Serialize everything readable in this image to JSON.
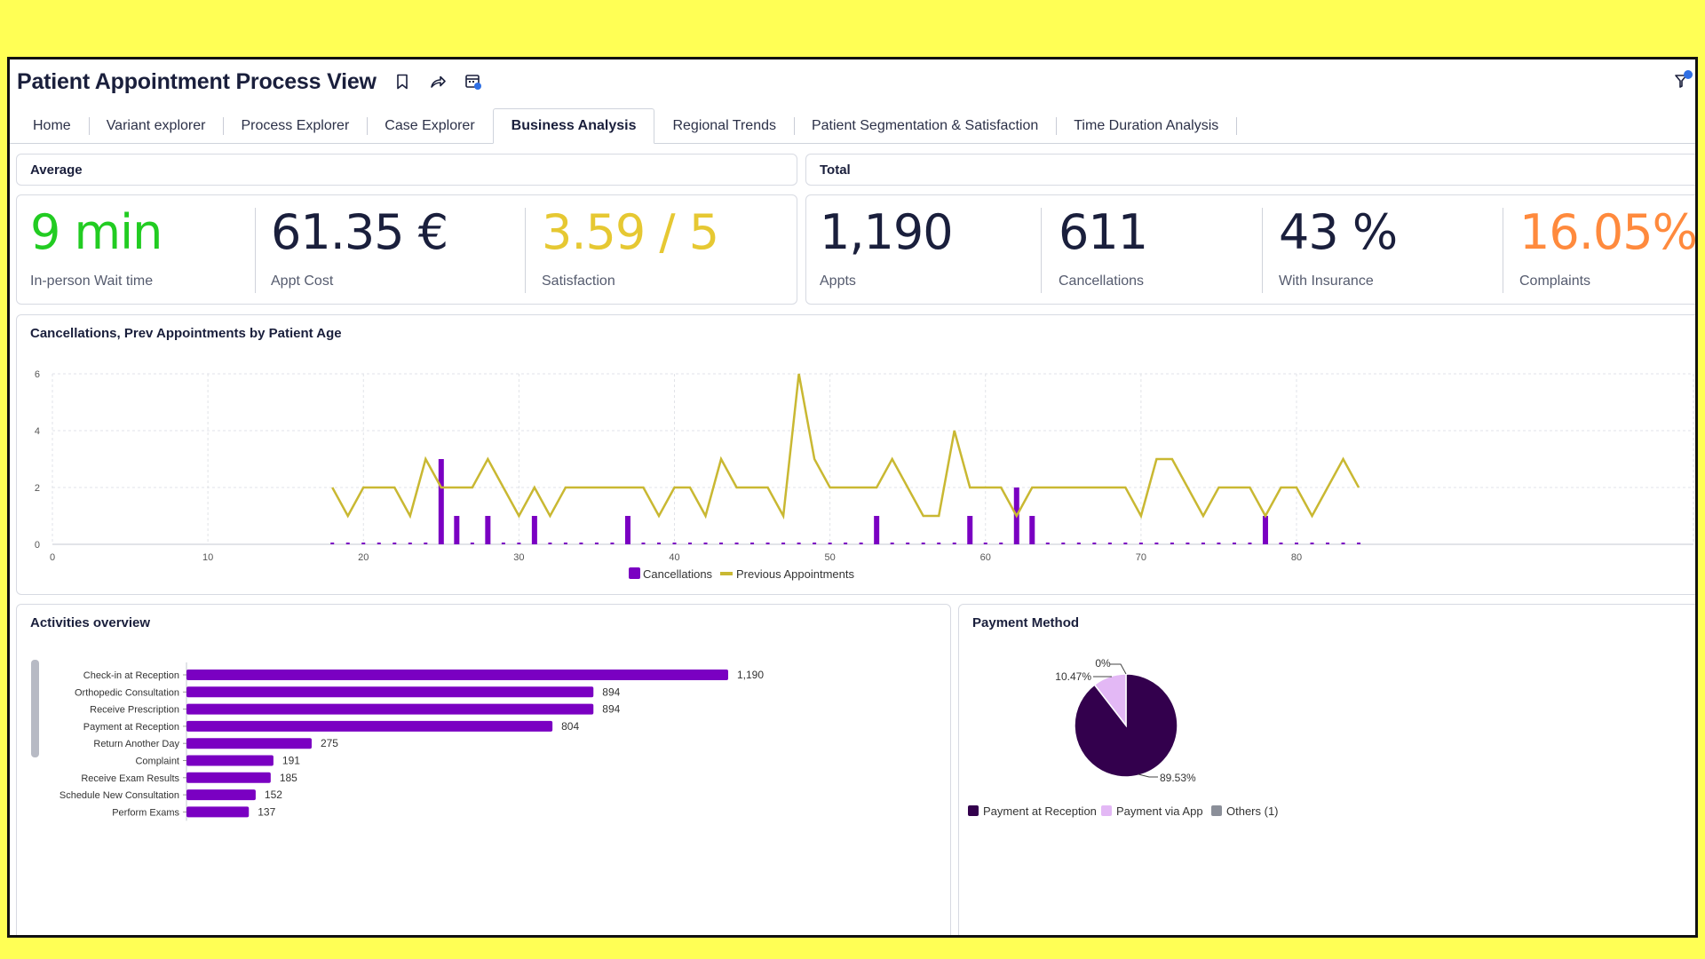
{
  "header": {
    "title": "Patient Appointment Process View"
  },
  "icons": {
    "bookmark": "bookmark-icon",
    "share": "share-icon",
    "calendar": "calendar-icon",
    "filter": "filter-icon"
  },
  "tabs": [
    {
      "label": "Home"
    },
    {
      "label": "Variant explorer"
    },
    {
      "label": "Process Explorer"
    },
    {
      "label": "Case Explorer"
    },
    {
      "label": "Business Analysis",
      "active": true
    },
    {
      "label": "Regional Trends"
    },
    {
      "label": "Patient Segmentation & Satisfaction"
    },
    {
      "label": "Time Duration Analysis"
    }
  ],
  "average": {
    "title": "Average",
    "kpis": [
      {
        "value": "9 min",
        "label": "In-person Wait time",
        "color": "#22cc22"
      },
      {
        "value": "61.35 €",
        "label": "Appt Cost",
        "color": "#1a1f3c"
      },
      {
        "value": "3.59 / 5",
        "label": "Satisfaction",
        "color": "#e6c832"
      }
    ]
  },
  "total": {
    "title": "Total",
    "kpis": [
      {
        "value": "1,190",
        "label": "Appts",
        "color": "#1a1f3c"
      },
      {
        "value": "611",
        "label": "Cancellations",
        "color": "#1a1f3c"
      },
      {
        "value": "43 %",
        "label": "With Insurance",
        "color": "#1a1f3c"
      },
      {
        "value": "16.05%",
        "label": "Complaints",
        "color": "#ff8a3d"
      }
    ]
  },
  "colors": {
    "purple": "#7a00c2",
    "olive": "#c9b832",
    "dark_purple": "#33004d",
    "light_purple": "#e3b8f5",
    "gray": "#8b8f99"
  },
  "chart_data": [
    {
      "type": "bar+line",
      "title": "Cancellations, Prev Appointments by Patient Age",
      "xlim": [
        0,
        85
      ],
      "ylim": [
        0,
        6
      ],
      "x_ticks": [
        0,
        10,
        20,
        30,
        40,
        50,
        60,
        70,
        80
      ],
      "y_ticks": [
        0,
        2,
        4,
        6
      ],
      "grid": true,
      "legend": "bottom",
      "series": [
        {
          "name": "Cancellations",
          "type": "bar",
          "color": "#7a00c2",
          "x": [
            18,
            19,
            20,
            21,
            22,
            23,
            24,
            25,
            26,
            27,
            28,
            29,
            30,
            31,
            32,
            33,
            34,
            35,
            36,
            37,
            38,
            39,
            40,
            41,
            42,
            43,
            44,
            45,
            46,
            47,
            48,
            49,
            50,
            51,
            52,
            53,
            54,
            55,
            56,
            57,
            58,
            59,
            60,
            61,
            62,
            63,
            64,
            65,
            66,
            67,
            68,
            69,
            70,
            71,
            72,
            73,
            74,
            75,
            76,
            77,
            78,
            79,
            80,
            81,
            82,
            83,
            84
          ],
          "values": [
            0,
            0,
            0,
            0,
            0,
            0,
            0,
            3,
            1,
            0,
            1,
            0,
            0,
            1,
            0,
            0,
            0,
            0,
            0,
            1,
            0,
            0,
            0,
            0,
            0,
            0,
            0,
            0,
            0,
            0,
            0,
            0,
            0,
            0,
            0,
            1,
            0,
            0,
            0,
            0,
            0,
            1,
            0,
            0,
            2,
            1,
            0,
            0,
            0,
            0,
            0,
            0,
            0,
            0,
            0,
            0,
            0,
            0,
            0,
            0,
            1,
            0,
            0,
            0,
            0,
            0,
            0
          ]
        },
        {
          "name": "Previous Appointments",
          "type": "line",
          "color": "#c9b832",
          "x": [
            18,
            19,
            20,
            21,
            22,
            23,
            24,
            25,
            26,
            27,
            28,
            29,
            30,
            31,
            32,
            33,
            34,
            35,
            36,
            37,
            38,
            39,
            40,
            41,
            42,
            43,
            44,
            45,
            46,
            47,
            48,
            49,
            50,
            51,
            52,
            53,
            54,
            55,
            56,
            57,
            58,
            59,
            60,
            61,
            62,
            63,
            64,
            65,
            66,
            67,
            68,
            69,
            70,
            71,
            72,
            73,
            74,
            75,
            76,
            77,
            78,
            79,
            80,
            81,
            82,
            83,
            84
          ],
          "values": [
            2,
            1,
            2,
            2,
            2,
            1,
            3,
            2,
            2,
            2,
            3,
            2,
            1,
            2,
            1,
            2,
            2,
            2,
            2,
            2,
            2,
            1,
            2,
            2,
            1,
            3,
            2,
            2,
            2,
            1,
            6,
            3,
            2,
            2,
            2,
            2,
            3,
            2,
            1,
            1,
            4,
            2,
            2,
            2,
            1,
            2,
            2,
            2,
            2,
            2,
            2,
            2,
            1,
            3,
            3,
            2,
            1,
            2,
            2,
            2,
            1,
            2,
            2,
            1,
            2,
            3,
            2
          ]
        }
      ]
    },
    {
      "type": "bar",
      "orientation": "horizontal",
      "title": "Activities overview",
      "categories": [
        "Check-in at Reception",
        "Orthopedic Consultation",
        "Receive Prescription",
        "Payment at Reception",
        "Return Another Day",
        "Complaint",
        "Receive Exam Results",
        "Schedule New Consultation",
        "Perform Exams"
      ],
      "values": [
        1190,
        894,
        894,
        804,
        275,
        191,
        185,
        152,
        137
      ],
      "value_labels": [
        "1,190",
        "894",
        "894",
        "804",
        "275",
        "191",
        "185",
        "152",
        "137"
      ],
      "color": "#7a00c2"
    },
    {
      "type": "pie",
      "title": "Payment Method",
      "labels": [
        "Payment at Reception",
        "Payment via App",
        "Others (1)"
      ],
      "values": [
        89.53,
        10.47,
        0
      ],
      "value_labels": [
        "89.53%",
        "10.47%",
        "0%"
      ],
      "colors": [
        "#33004d",
        "#e3b8f5",
        "#8b8f99"
      ],
      "legend": "bottom"
    }
  ]
}
